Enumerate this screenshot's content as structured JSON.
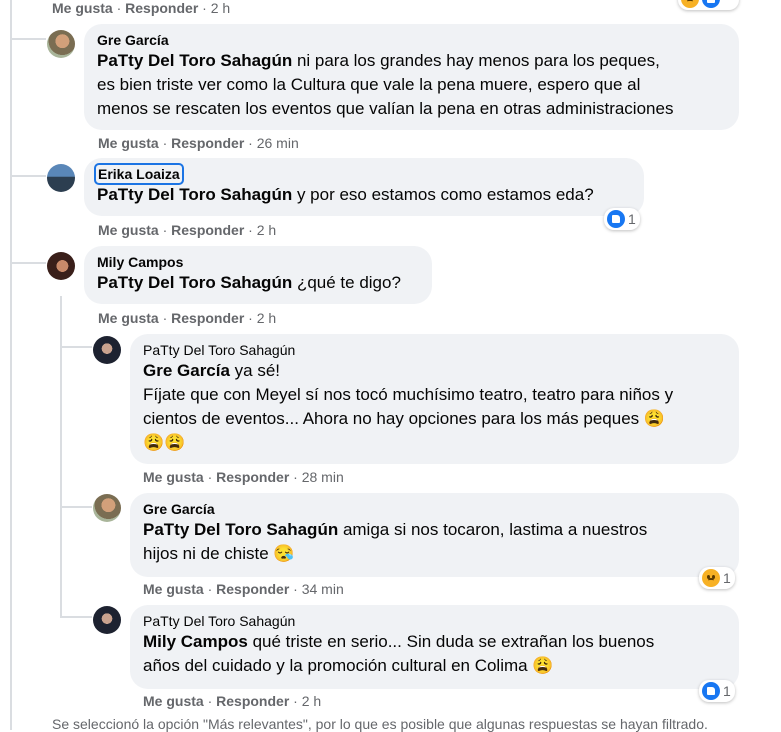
{
  "top_meta": {
    "like": "Me gusta",
    "reply": "Responder",
    "time": "2 h"
  },
  "comments": [
    {
      "author": "Gre García",
      "mention": "PaTty Del Toro Sahagún",
      "line1": " ni para los grandes hay menos para los peques,",
      "line2": "es bien triste ver como la Cultura que vale la pena muere, espero que al",
      "line3": "menos se rescaten los eventos que valían la pena en otras administraciones",
      "like": "Me gusta",
      "reply": "Responder",
      "time": "26 min"
    },
    {
      "author": "Erika Loaiza",
      "mention": "PaTty Del Toro Sahagún",
      "line1": " y por eso estamos como estamos eda?",
      "like": "Me gusta",
      "reply": "Responder",
      "time": "2 h",
      "reaction_count": "1"
    },
    {
      "author": "Mily Campos",
      "mention": "PaTty Del Toro Sahagún",
      "line1": " ¿qué te digo?",
      "like": "Me gusta",
      "reply": "Responder",
      "time": "2 h"
    }
  ],
  "replies": [
    {
      "author": "PaTty Del Toro Sahagún",
      "mention": "Gre García",
      "line1": " ya sé!",
      "line2": "Fíjate que con Meyel sí nos tocó muchísimo teatro, teatro para niños y",
      "line3": "cientos de eventos... Ahora no hay opciones para los más peques 😩",
      "line4": "😩😩",
      "like": "Me gusta",
      "reply": "Responder",
      "time": "28 min"
    },
    {
      "author": "Gre García",
      "mention": "PaTty Del Toro Sahagún",
      "line1": " amiga si nos tocaron, lastima a nuestros",
      "line2": "hijos ni de chiste 😪",
      "like": "Me gusta",
      "reply": "Responder",
      "time": "34 min",
      "reaction_count": "1"
    },
    {
      "author": "PaTty Del Toro Sahagún",
      "mention": "Mily Campos",
      "line1": " qué triste en serio... Sin duda se extrañan los buenos",
      "line2": "años del cuidado y la promoción cultural en Colima 😩",
      "like": "Me gusta",
      "reply": "Responder",
      "time": "2 h",
      "reaction_count": "1"
    }
  ],
  "footer_note": "Se seleccionó la opción \"Más relevantes\", por lo que es posible que algunas respuestas se hayan filtrado.",
  "colors": {
    "bubble": "#f0f2f5",
    "meta": "#65676b",
    "like_blue": "#1877f2",
    "focus": "#1b74e4"
  }
}
